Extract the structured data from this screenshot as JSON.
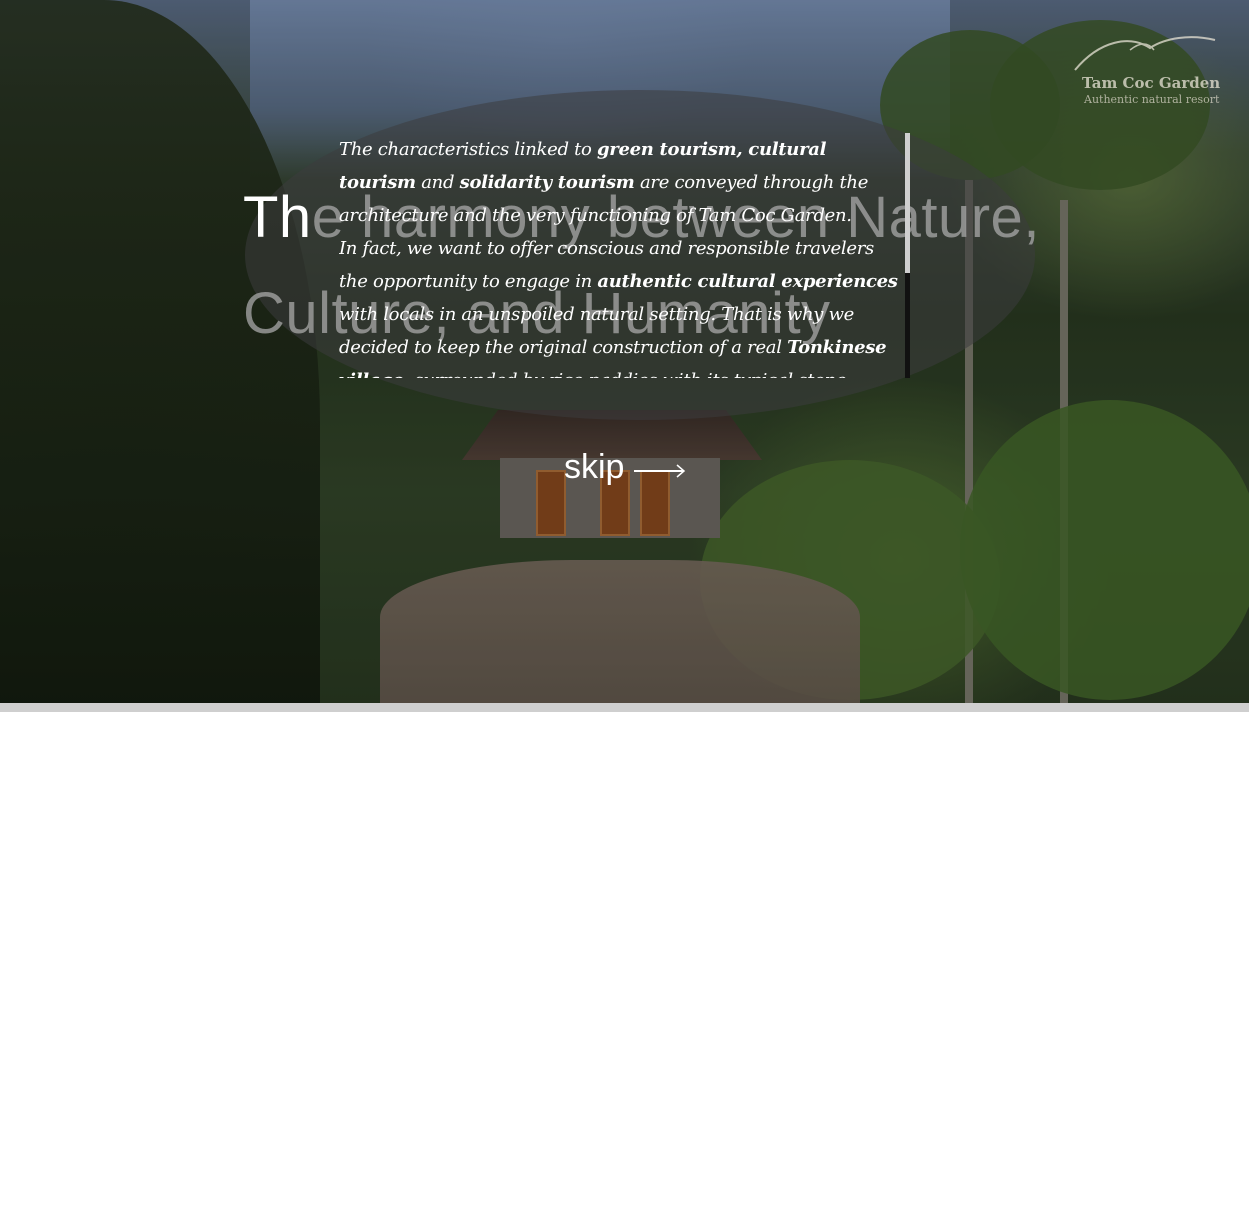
{
  "logo": {
    "name": "Tam Coc Garden",
    "tagline": "Authentic natural resort"
  },
  "headline": {
    "lead": "Th",
    "rest": "e harmony between Nature, Culture, and Humanity"
  },
  "story": {
    "p1": [
      {
        "t": "The characteristics linked to "
      },
      {
        "t": "green tourism, cultural tourism",
        "b": true
      },
      {
        "t": " and "
      },
      {
        "t": "solidarity tourism",
        "b": true
      },
      {
        "t": " are conveyed through the architecture and the very functioning of Tam Coc Garden."
      }
    ],
    "p2": [
      {
        "t": "In fact, we want to offer conscious and responsible travelers the opportunity to engage in "
      },
      {
        "t": "authentic cultural experiences",
        "b": true
      },
      {
        "t": " with locals in an unspoiled natural setting. That is why we decided to keep the original construction of a real "
      },
      {
        "t": "Tonkinese village",
        "b": true
      },
      {
        "t": ", surrounded by rice paddies with its typical stone houses and tile roofs, hardwood structures and natural"
      }
    ],
    "scroll_fraction": 0.57
  },
  "skip": {
    "label": "skip"
  },
  "colors": {
    "overlay": "#3c3c3e",
    "text": "#ffffff",
    "bar": "#cfcfcf"
  }
}
